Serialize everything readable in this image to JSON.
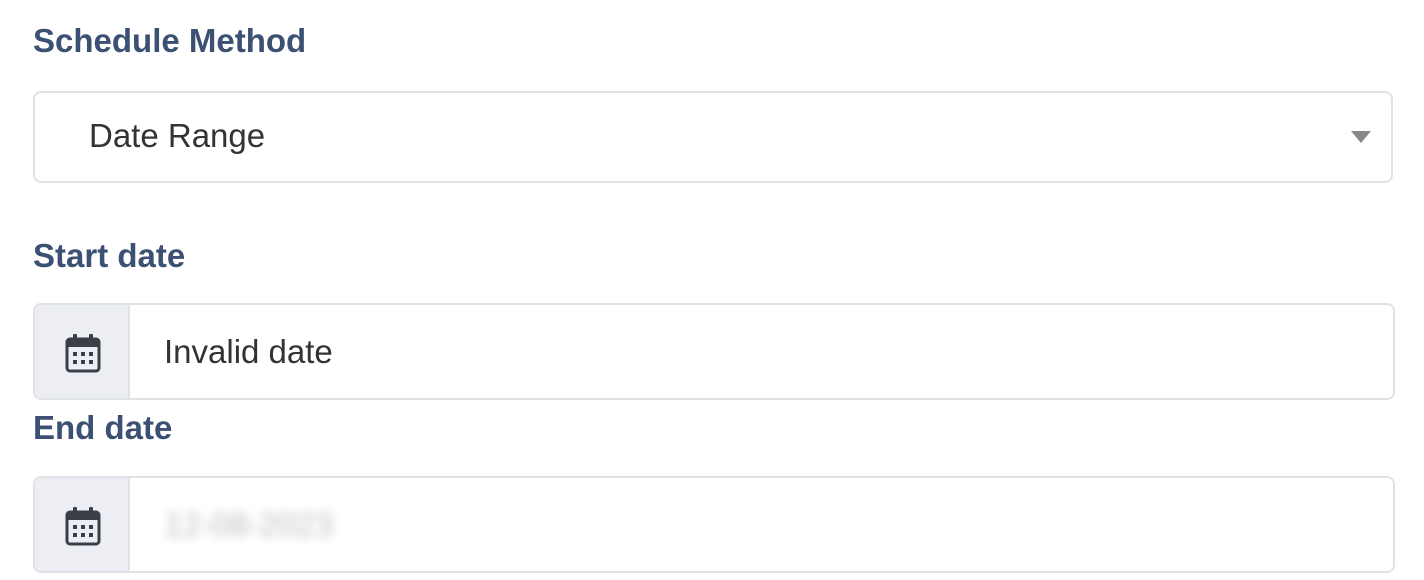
{
  "form": {
    "schedule_method": {
      "label": "Schedule Method",
      "selected": "Date Range"
    },
    "start_date": {
      "label": "Start date",
      "value": "Invalid date",
      "icon": "calendar-icon"
    },
    "end_date": {
      "label": "End date",
      "value": "12-08-2023",
      "icon": "calendar-icon",
      "obscured": true
    }
  },
  "colors": {
    "label": "#3b5072",
    "border": "#dfe3e8",
    "addon_bg": "#eceef3",
    "text": "#333333",
    "caret": "#888888"
  }
}
